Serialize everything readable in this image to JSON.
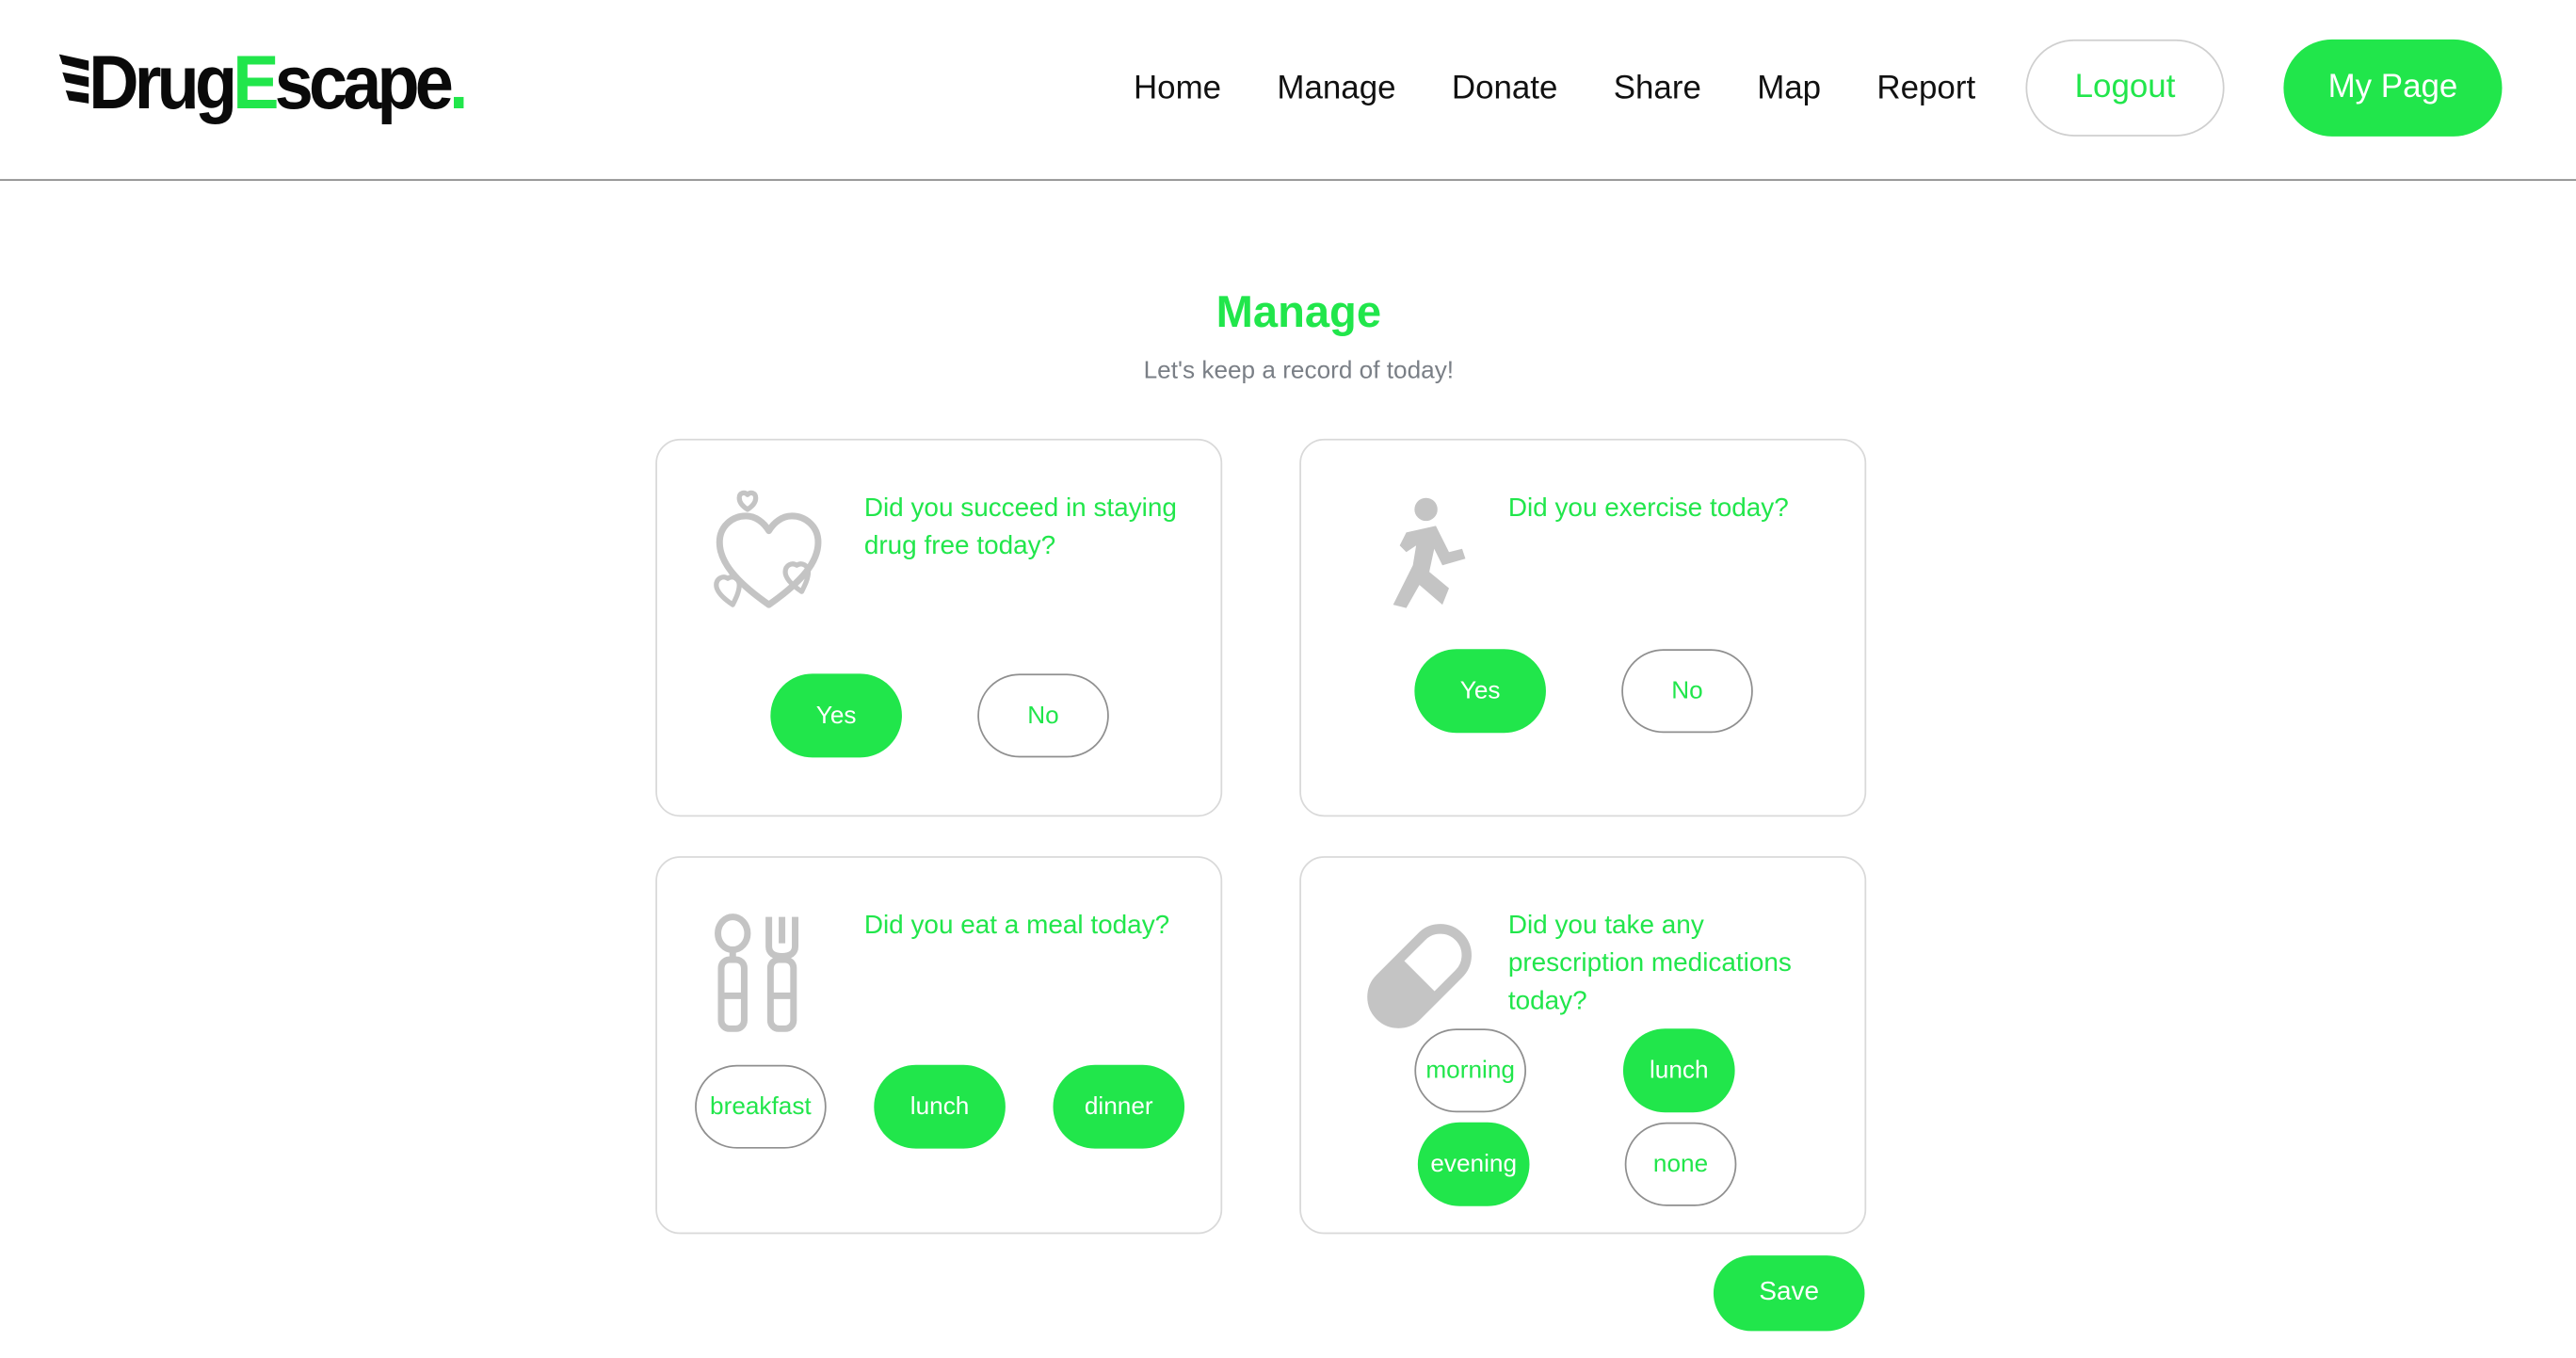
{
  "brand": {
    "logo_part1": "Drug",
    "logo_part2": "E",
    "logo_part3": "scape",
    "logo_dot": ".",
    "accent_color": "#21e64b",
    "dark_color": "#0a0a0a"
  },
  "nav": {
    "items": [
      {
        "label": "Home"
      },
      {
        "label": "Manage"
      },
      {
        "label": "Donate"
      },
      {
        "label": "Share"
      },
      {
        "label": "Map"
      },
      {
        "label": "Report"
      }
    ],
    "logout_label": "Logout",
    "mypage_label": "My Page"
  },
  "page": {
    "title": "Manage",
    "subtitle": "Let's keep a record of today!"
  },
  "cards": {
    "drug_free": {
      "icon": "hearts-icon",
      "question": "Did you succeed in staying drug free today?",
      "yes_label": "Yes",
      "no_label": "No",
      "selected": "Yes"
    },
    "exercise": {
      "icon": "running-person-icon",
      "question": "Did you exercise today?",
      "yes_label": "Yes",
      "no_label": "No",
      "selected": "Yes"
    },
    "meal": {
      "icon": "spoon-fork-icon",
      "question": "Did you eat a meal today?",
      "options": [
        {
          "label": "breakfast",
          "selected": false
        },
        {
          "label": "lunch",
          "selected": true
        },
        {
          "label": "dinner",
          "selected": true
        }
      ]
    },
    "medication": {
      "icon": "pill-capsule-icon",
      "question": "Did you take any prescription medications today?",
      "options": [
        {
          "label": "morning",
          "selected": false
        },
        {
          "label": "lunch",
          "selected": true
        },
        {
          "label": "evening",
          "selected": true
        },
        {
          "label": "none",
          "selected": false
        }
      ]
    }
  },
  "save_label": "Save"
}
